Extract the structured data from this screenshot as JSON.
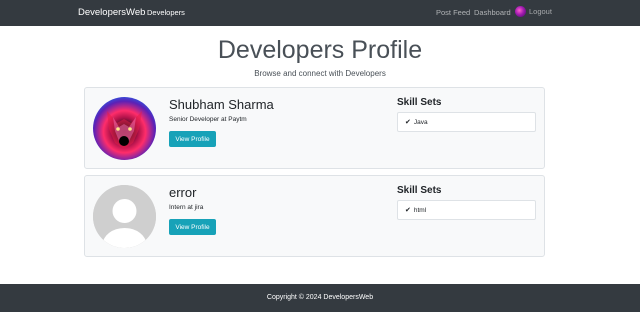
{
  "navbar": {
    "brand": "DevelopersWeb",
    "developers": "Developers",
    "post_feed": "Post Feed",
    "dashboard": "Dashboard",
    "logout": "Logout"
  },
  "header": {
    "title": "Developers Profile",
    "subtitle": "Browse and connect with Developers"
  },
  "profiles": [
    {
      "name": "Shubham Sharma",
      "status": "Senior Developer at Paytm",
      "button": "View Profile",
      "skills_title": "Skill Sets",
      "skills": [
        "Java"
      ],
      "avatar": "wolf-artwork"
    },
    {
      "name": "error",
      "status": "Intern at jira",
      "button": "View Profile",
      "skills_title": "Skill Sets",
      "skills": [
        "html"
      ],
      "avatar": "default-user-placeholder"
    }
  ],
  "footer": {
    "text": "Copyright © 2024 DevelopersWeb"
  },
  "colors": {
    "navbar_bg": "#343a40",
    "button_bg": "#17a2b8",
    "card_bg": "#f8f9fa"
  },
  "icons": {
    "check": "check-icon",
    "logout_avatar": "user-avatar-icon"
  }
}
